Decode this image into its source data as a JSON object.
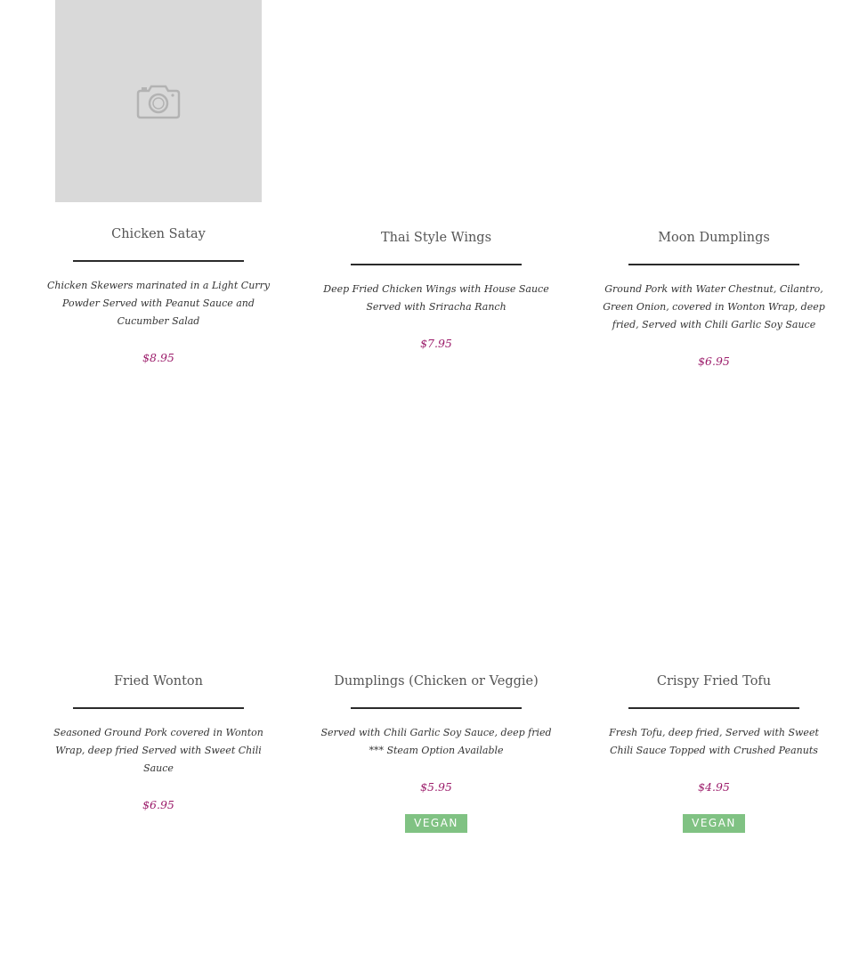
{
  "menu_items": [
    {
      "name": "Chicken Satay",
      "description": "Chicken Skewers marinated in a Light Curry Powder Served with Peanut Sauce and Cucumber Salad",
      "price": "$8.95",
      "image": "camera-placeholder-icon"
    },
    {
      "name": "Thai Style Wings",
      "description": "Deep Fried Chicken Wings with House Sauce Served with Sriracha Ranch",
      "price": "$7.95"
    },
    {
      "name": "Moon Dumplings",
      "description": "Ground Pork with Water Chestnut, Cilantro, Green Onion, covered in Wonton Wrap, deep fried, Served with Chili Garlic Soy Sauce",
      "price": "$6.95"
    },
    {
      "name": "Fried Wonton",
      "description": "Seasoned Ground Pork covered in Wonton Wrap, deep fried Served with Sweet Chili Sauce",
      "price": "$6.95"
    },
    {
      "name": "Dumplings (Chicken or Veggie)",
      "description": "Served with Chili Garlic Soy Sauce, deep fried *** Steam Option Available",
      "price": "$5.95",
      "badge": "VEGAN"
    },
    {
      "name": "Crispy Fried Tofu",
      "description": "Fresh Tofu, deep fried, Served with Sweet Chili Sauce Topped with Crushed Peanuts",
      "price": "$4.95",
      "badge": "VEGAN"
    }
  ],
  "colors": {
    "price": "#9c1d6b",
    "badge_bg": "#80c283",
    "rule": "#2b2b2b",
    "placeholder_bg": "#d9d9d9"
  }
}
